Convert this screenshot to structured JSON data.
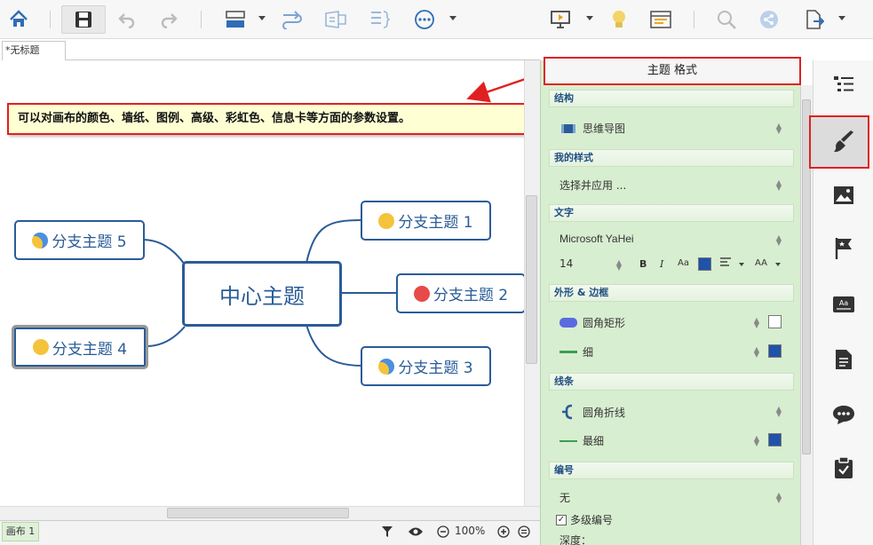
{
  "tab": {
    "title": "*无标题"
  },
  "callout": {
    "text": "可以对画布的颜色、墙纸、图例、高级、彩虹色、信息卡等方面的参数设置。"
  },
  "mindmap": {
    "central": "中心主题",
    "branches": [
      "分支主题 1",
      "分支主题 2",
      "分支主题 3",
      "分支主题 4",
      "分支主题 5"
    ]
  },
  "panel": {
    "title": "主题 格式",
    "structure": {
      "header": "结构",
      "value": "思维导图"
    },
    "my_style": {
      "header": "我的样式",
      "value": "选择并应用 ..."
    },
    "text": {
      "header": "文字",
      "font": "Microsoft YaHei",
      "size": "14",
      "bold": "B",
      "italic": "I",
      "case": "Aa",
      "fontsize_btn": "AA"
    },
    "shape": {
      "header": "外形 & 边框",
      "shape_value": "圆角矩形",
      "border_value": "细"
    },
    "line": {
      "header": "线条",
      "line_value": "圆角折线",
      "weight_value": "最细"
    },
    "numbering": {
      "header": "编号",
      "value": "无",
      "multilevel": "多级编号",
      "depth": "深度："
    }
  },
  "status": {
    "sheet": "画布 1",
    "zoom": "100%"
  },
  "colors": {
    "accent": "#2a5c97",
    "highlight": "#e02020",
    "panel_bg": "#d8eed0",
    "swatch_blue": "#1f52a8"
  }
}
